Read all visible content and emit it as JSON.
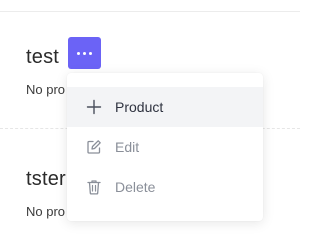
{
  "lists": [
    {
      "title": "test",
      "subtitle": "No pro"
    },
    {
      "title": "tster",
      "subtitle": "No pro"
    }
  ],
  "menu": {
    "items": [
      {
        "label": "Product",
        "icon": "plus-icon"
      },
      {
        "label": "Edit",
        "icon": "edit-icon"
      },
      {
        "label": "Delete",
        "icon": "trash-icon"
      }
    ]
  },
  "colors": {
    "accent": "#6b63f6",
    "menu_highlight": "#f3f4f6",
    "muted_text": "#8a8f99"
  }
}
